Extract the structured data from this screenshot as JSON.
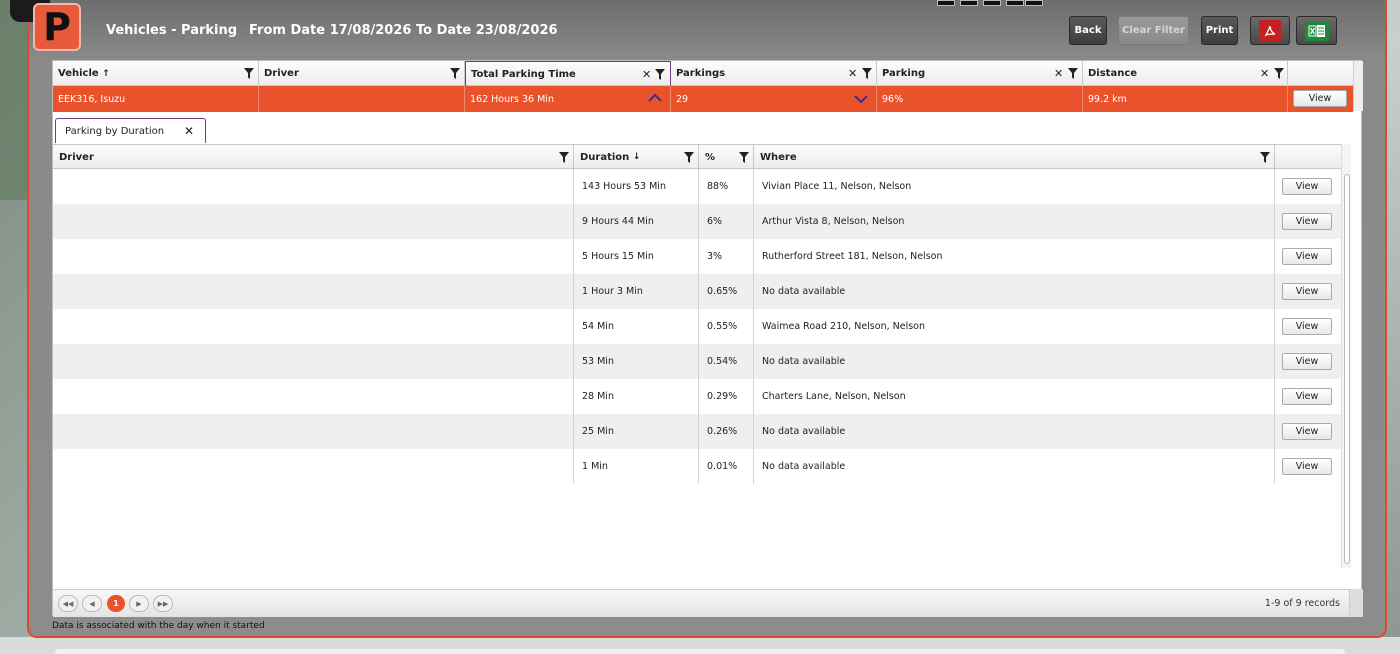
{
  "header": {
    "logo_letter": "P",
    "title": "Vehicles - Parking",
    "date_range": "From Date 17/08/2026 To Date 23/08/2026"
  },
  "toolbar": {
    "back_label": "Back",
    "clear_filter_label": "Clear Filter",
    "print_label": "Print",
    "pdf_icon": "pdf-export-icon",
    "excel_icon": "excel-export-icon"
  },
  "master_grid": {
    "columns": [
      {
        "label": "Vehicle",
        "sort": "↑"
      },
      {
        "label": "Driver"
      },
      {
        "label": "Total Parking Time"
      },
      {
        "label": "Parkings"
      },
      {
        "label": "Parking"
      },
      {
        "label": "Distance"
      }
    ],
    "row": {
      "vehicle": "EEK316, Isuzu",
      "driver": "",
      "total_parking_time": "162 Hours 36 Min",
      "parkings": "29",
      "parking": "96%",
      "distance": "99.2 km",
      "view_label": "View"
    }
  },
  "tab": {
    "label": "Parking by Duration"
  },
  "detail_grid": {
    "columns": [
      {
        "label": "Driver"
      },
      {
        "label": "Duration",
        "sort": "↓"
      },
      {
        "label": "%"
      },
      {
        "label": "Where"
      }
    ],
    "rows": [
      {
        "driver": "",
        "duration": "143 Hours 53 Min",
        "pct": "88%",
        "where": "Vivian Place 11, Nelson, Nelson",
        "view": "View"
      },
      {
        "driver": "",
        "duration": "9 Hours 44 Min",
        "pct": "6%",
        "where": "Arthur Vista 8, Nelson, Nelson",
        "view": "View"
      },
      {
        "driver": "",
        "duration": "5 Hours 15 Min",
        "pct": "3%",
        "where": "Rutherford Street 181, Nelson, Nelson",
        "view": "View"
      },
      {
        "driver": "",
        "duration": "1 Hour 3 Min",
        "pct": "0.65%",
        "where": "No data available",
        "view": "View"
      },
      {
        "driver": "",
        "duration": "54 Min",
        "pct": "0.55%",
        "where": "Waimea Road 210, Nelson, Nelson",
        "view": "View"
      },
      {
        "driver": "",
        "duration": "53 Min",
        "pct": "0.54%",
        "where": "No data available",
        "view": "View"
      },
      {
        "driver": "",
        "duration": "28 Min",
        "pct": "0.29%",
        "where": "Charters Lane, Nelson, Nelson",
        "view": "View"
      },
      {
        "driver": "",
        "duration": "25 Min",
        "pct": "0.26%",
        "where": "No data available",
        "view": "View"
      },
      {
        "driver": "",
        "duration": "1 Min",
        "pct": "0.01%",
        "where": "No data available",
        "view": "View"
      }
    ]
  },
  "pager": {
    "current_page": "1",
    "records": "1-9 of 9 records"
  },
  "footnote": "Data is associated with the day when it started",
  "colors": {
    "accent": "#e9532c",
    "selected_border": "#6f3c88"
  }
}
